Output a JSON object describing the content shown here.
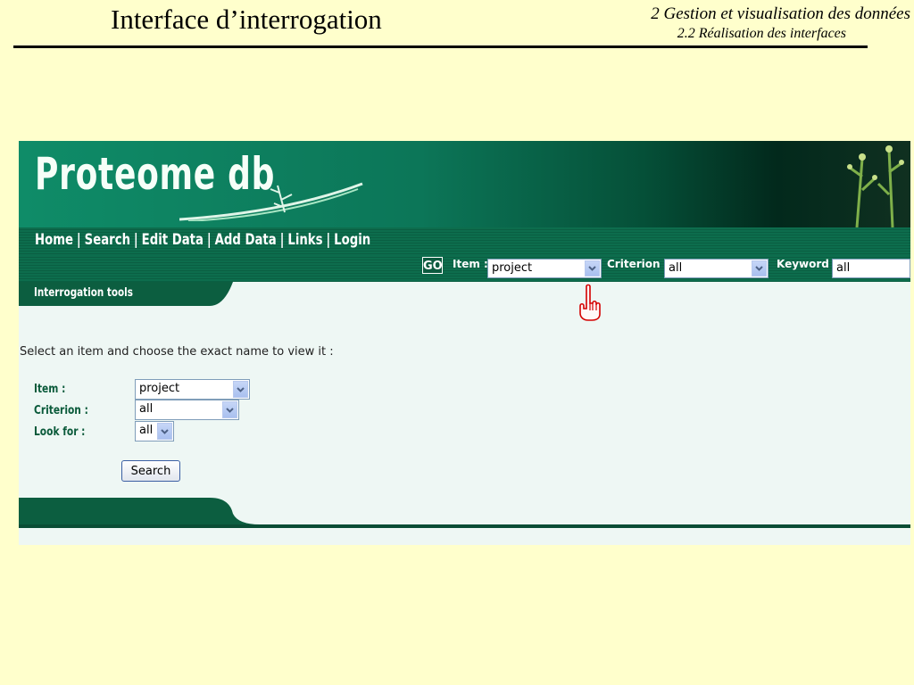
{
  "slide": {
    "title": "Interface d’interrogation",
    "section": "2 Gestion et visualisation des données",
    "subsection": "2.2 Réalisation des interfaces"
  },
  "app": {
    "logo": "Proteome db",
    "nav": [
      "Home",
      "Search",
      "Edit Data",
      "Add Data",
      "Links",
      "Login"
    ],
    "nav_separator": "|",
    "quick_search": {
      "go_label": "GO",
      "item_label": "Item :",
      "item_value": "project",
      "criterion_label": "Criterion :",
      "criterion_value": "all",
      "keyword_label": "Keyword :",
      "keyword_value": "all"
    },
    "tools_title": "Interrogation tools",
    "instructions": "Select an item and choose the exact name to view it :",
    "form": {
      "item_label": "Item :",
      "item_value": "project",
      "criterion_label": "Criterion :",
      "criterion_value": "all",
      "lookfor_label": "Look for :",
      "lookfor_value": "all",
      "search_button": "Search"
    }
  },
  "colors": {
    "slide_background": "#ffffcc",
    "header_green": "#0c7658",
    "nav_green": "#0d6d4d",
    "panel_background": "#eef7f4",
    "form_label_green": "#0a5a3a",
    "pointer_red": "#d40000"
  }
}
